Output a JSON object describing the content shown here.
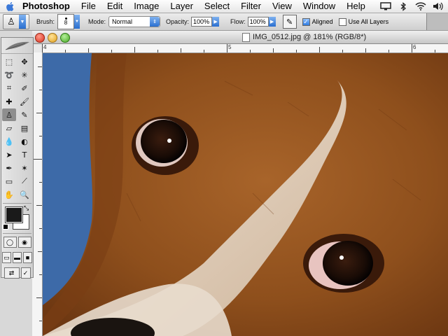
{
  "menubar": {
    "app_name": "Photoshop",
    "items": [
      "File",
      "Edit",
      "Image",
      "Layer",
      "Select",
      "Filter",
      "View",
      "Window",
      "Help"
    ],
    "status_icons": [
      "display-icon",
      "bluetooth-icon",
      "wifi-icon",
      "volume-icon"
    ]
  },
  "options_bar": {
    "brush_label": "Brush:",
    "brush_size": "8",
    "mode_label": "Mode:",
    "mode_value": "Normal",
    "opacity_label": "Opacity:",
    "opacity_value": "100%",
    "flow_label": "Flow:",
    "flow_value": "100%",
    "aligned_label": "Aligned",
    "aligned_checked": true,
    "use_all_layers_label": "Use All Layers",
    "use_all_layers_checked": false
  },
  "document": {
    "title": "IMG_0512.jpg @ 181% (RGB/8*)",
    "ruler_top_numbers": [
      "4",
      "5",
      "6"
    ],
    "ruler_left_numbers": [
      "2",
      "3",
      "4",
      "5"
    ]
  },
  "toolbox": {
    "selected_tool": "clone-stamp-tool",
    "foreground_color": "#1a1a1a",
    "background_color": "#ffffff"
  },
  "colors": {
    "selection_accent": "#2a6fd0",
    "fur_brown": "#9b5a22",
    "sky_blue": "#3d6aa8"
  }
}
